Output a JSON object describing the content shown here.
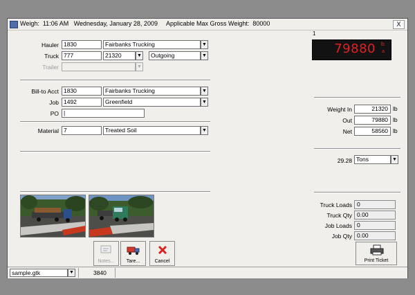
{
  "window": {
    "title": "Weigh:  11:06 AM   Wednesday, January 28, 2009     Applicable Max Gross Weight:  80000",
    "close_label": "X",
    "scale_number": "1"
  },
  "form": {
    "hauler": {
      "label": "Hauler",
      "code": "1830",
      "name": "Fairbanks Trucking"
    },
    "truck": {
      "label": "Truck",
      "code": "777",
      "number": "21320",
      "direction": "Outgoing"
    },
    "trailer": {
      "label": "Trailer",
      "code": ""
    },
    "billto": {
      "label": "Bill-to Acct",
      "code": "1830",
      "name": "Fairbanks Trucking"
    },
    "job": {
      "label": "Job",
      "code": "1492",
      "name": "Greenfield"
    },
    "po": {
      "label": "PO",
      "value": "|"
    },
    "material": {
      "label": "Material",
      "code": "7",
      "name": "Treated Soil"
    }
  },
  "scale_display": {
    "value": "79880",
    "unit_top": "lb",
    "unit_bottom": "a",
    "color": "#e51f1f"
  },
  "weights": {
    "in_label": "Weight In",
    "in_value": "21320",
    "in_unit": "lb",
    "out_label": "Out",
    "out_value": "79880",
    "out_unit": "lb",
    "net_label": "Net",
    "net_value": "58560",
    "net_unit": "lb"
  },
  "conversion": {
    "value": "29.28",
    "unit": "Tons"
  },
  "stats": {
    "truck_loads_label": "Truck Loads",
    "truck_loads": "0",
    "truck_qty_label": "Truck Qty",
    "truck_qty": "0.00",
    "job_loads_label": "Job Loads",
    "job_loads": "0",
    "job_qty_label": "Job Qty",
    "job_qty": "0.00"
  },
  "buttons": {
    "notes": "Notes...",
    "tare": "Tare...",
    "cancel": "Cancel",
    "print": "Print Ticket"
  },
  "icons": {
    "notes": "notes-icon",
    "tare": "truck-icon",
    "cancel": "cancel-x-icon",
    "print": "printer-icon"
  },
  "statusbar": {
    "file": "sample.gtk",
    "count": "3840"
  }
}
